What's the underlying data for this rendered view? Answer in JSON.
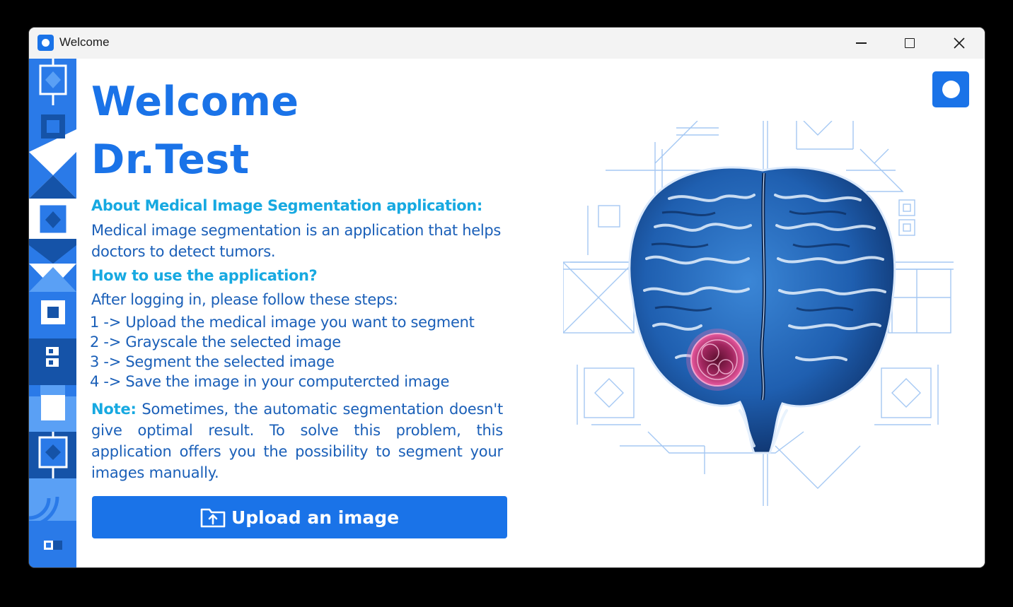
{
  "window": {
    "title": "Welcome"
  },
  "content": {
    "welcome": "Welcome",
    "doctor_name": "Dr.Test",
    "about_heading": "About Medical Image Segmentation application:",
    "about_text": "Medical image segmentation is an application that helps doctors to detect tumors.",
    "how_heading": "How to use the application?",
    "after_login": "After logging in, please follow these steps:",
    "steps": [
      "1 -> Upload the medical image you want to segment",
      "2 -> Grayscale the selected image",
      "3 -> Segment the selected image",
      "4 -> Save the image in your computercted image"
    ],
    "note_label": "Note:",
    "note_text": " Sometimes, the automatic segmentation doesn't give optimal result. To solve this problem, this application offers you the possibility to segment your images manually.",
    "upload_button": "Upload an image"
  },
  "icons": {
    "app": "app-circle-icon",
    "profile": "profile-circle-icon",
    "upload": "folder-upload-icon"
  },
  "colors": {
    "accent": "#1a73e8",
    "heading": "#17a9e1",
    "body_text": "#1a5fb8",
    "sidebar": "#2a7ae8"
  }
}
